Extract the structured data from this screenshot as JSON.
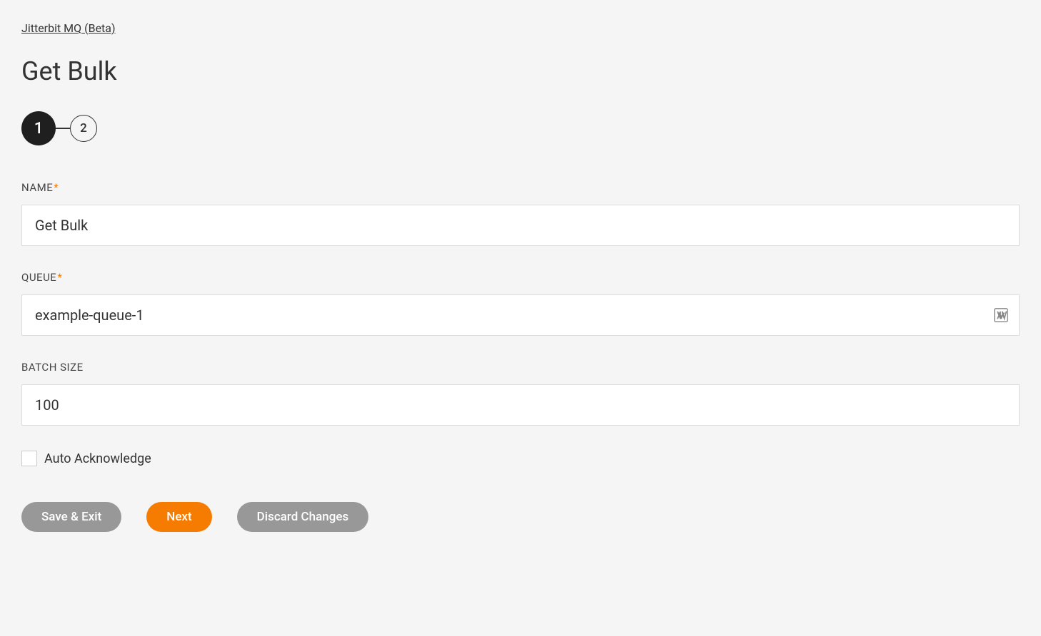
{
  "breadcrumb": "Jitterbit MQ (Beta)",
  "title": "Get Bulk",
  "stepper": {
    "step1": "1",
    "step2": "2"
  },
  "form": {
    "name": {
      "label": "NAME",
      "value": "Get Bulk"
    },
    "queue": {
      "label": "QUEUE",
      "value": "example-queue-1"
    },
    "batchSize": {
      "label": "BATCH SIZE",
      "value": "100"
    },
    "autoAck": {
      "label": "Auto Acknowledge"
    }
  },
  "buttons": {
    "saveExit": "Save & Exit",
    "next": "Next",
    "discard": "Discard Changes"
  }
}
